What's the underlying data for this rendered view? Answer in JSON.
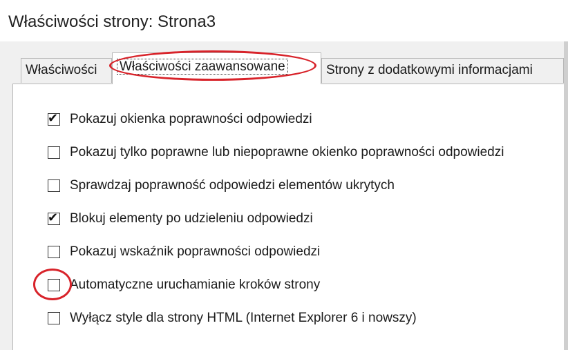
{
  "window": {
    "title": "Właściwości strony: Strona3"
  },
  "tabs": [
    {
      "label": "Właściwości",
      "active": false
    },
    {
      "label": "Właściwości zaawansowane",
      "active": true
    },
    {
      "label": "Strony z dodatkowymi informacjami",
      "active": false
    }
  ],
  "options": [
    {
      "label": "Pokazuj okienka poprawności odpowiedzi",
      "checked": true
    },
    {
      "label": "Pokazuj tylko poprawne lub niepoprawne okienko poprawności odpowiedzi",
      "checked": false
    },
    {
      "label": "Sprawdzaj poprawność odpowiedzi elementów ukrytych",
      "checked": false
    },
    {
      "label": "Blokuj elementy po udzieleniu odpowiedzi",
      "checked": true
    },
    {
      "label": "Pokazuj wskaźnik poprawności odpowiedzi",
      "checked": false
    },
    {
      "label": "Automatyczne uruchamianie kroków strony",
      "checked": false
    },
    {
      "label": "Wyłącz style dla strony HTML (Internet Explorer 6 i nowszy)",
      "checked": false
    }
  ],
  "annotations": {
    "highlight_color": "#d8232a"
  },
  "check_glyph": "✔"
}
